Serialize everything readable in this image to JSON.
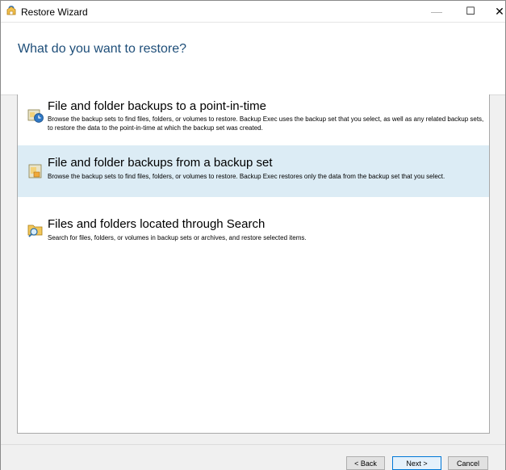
{
  "window": {
    "title": "Restore Wizard",
    "controls": {
      "minimize": "—",
      "maximize": "☐",
      "close": "✕"
    }
  },
  "header": {
    "title": "What do you want to restore?"
  },
  "options": [
    {
      "title": "File and folder backups to a point-in-time",
      "description": "Browse the backup sets to find files, folders, or volumes to restore. Backup Exec uses the backup set that you select, as well as any related backup sets, to restore the data to the point-in-time at which the backup set was created.",
      "icon": "backup-clock-icon",
      "selected": false
    },
    {
      "title": "File and folder backups from a backup set",
      "description": "Browse the backup sets to find files, folders, or volumes to restore. Backup Exec restores only the data from the backup set that you select.",
      "icon": "backup-set-icon",
      "selected": true
    },
    {
      "title": "Files and folders located through Search",
      "description": "Search for files, folders, or volumes in backup sets or archives, and restore selected items.",
      "icon": "folder-search-icon",
      "selected": false
    }
  ],
  "buttons": {
    "back": "< Back",
    "next": "Next >",
    "cancel": "Cancel"
  },
  "colors": {
    "header_text": "#1e4e79",
    "selected_bg": "#dcecf5",
    "default_button_border": "#0078d7"
  }
}
